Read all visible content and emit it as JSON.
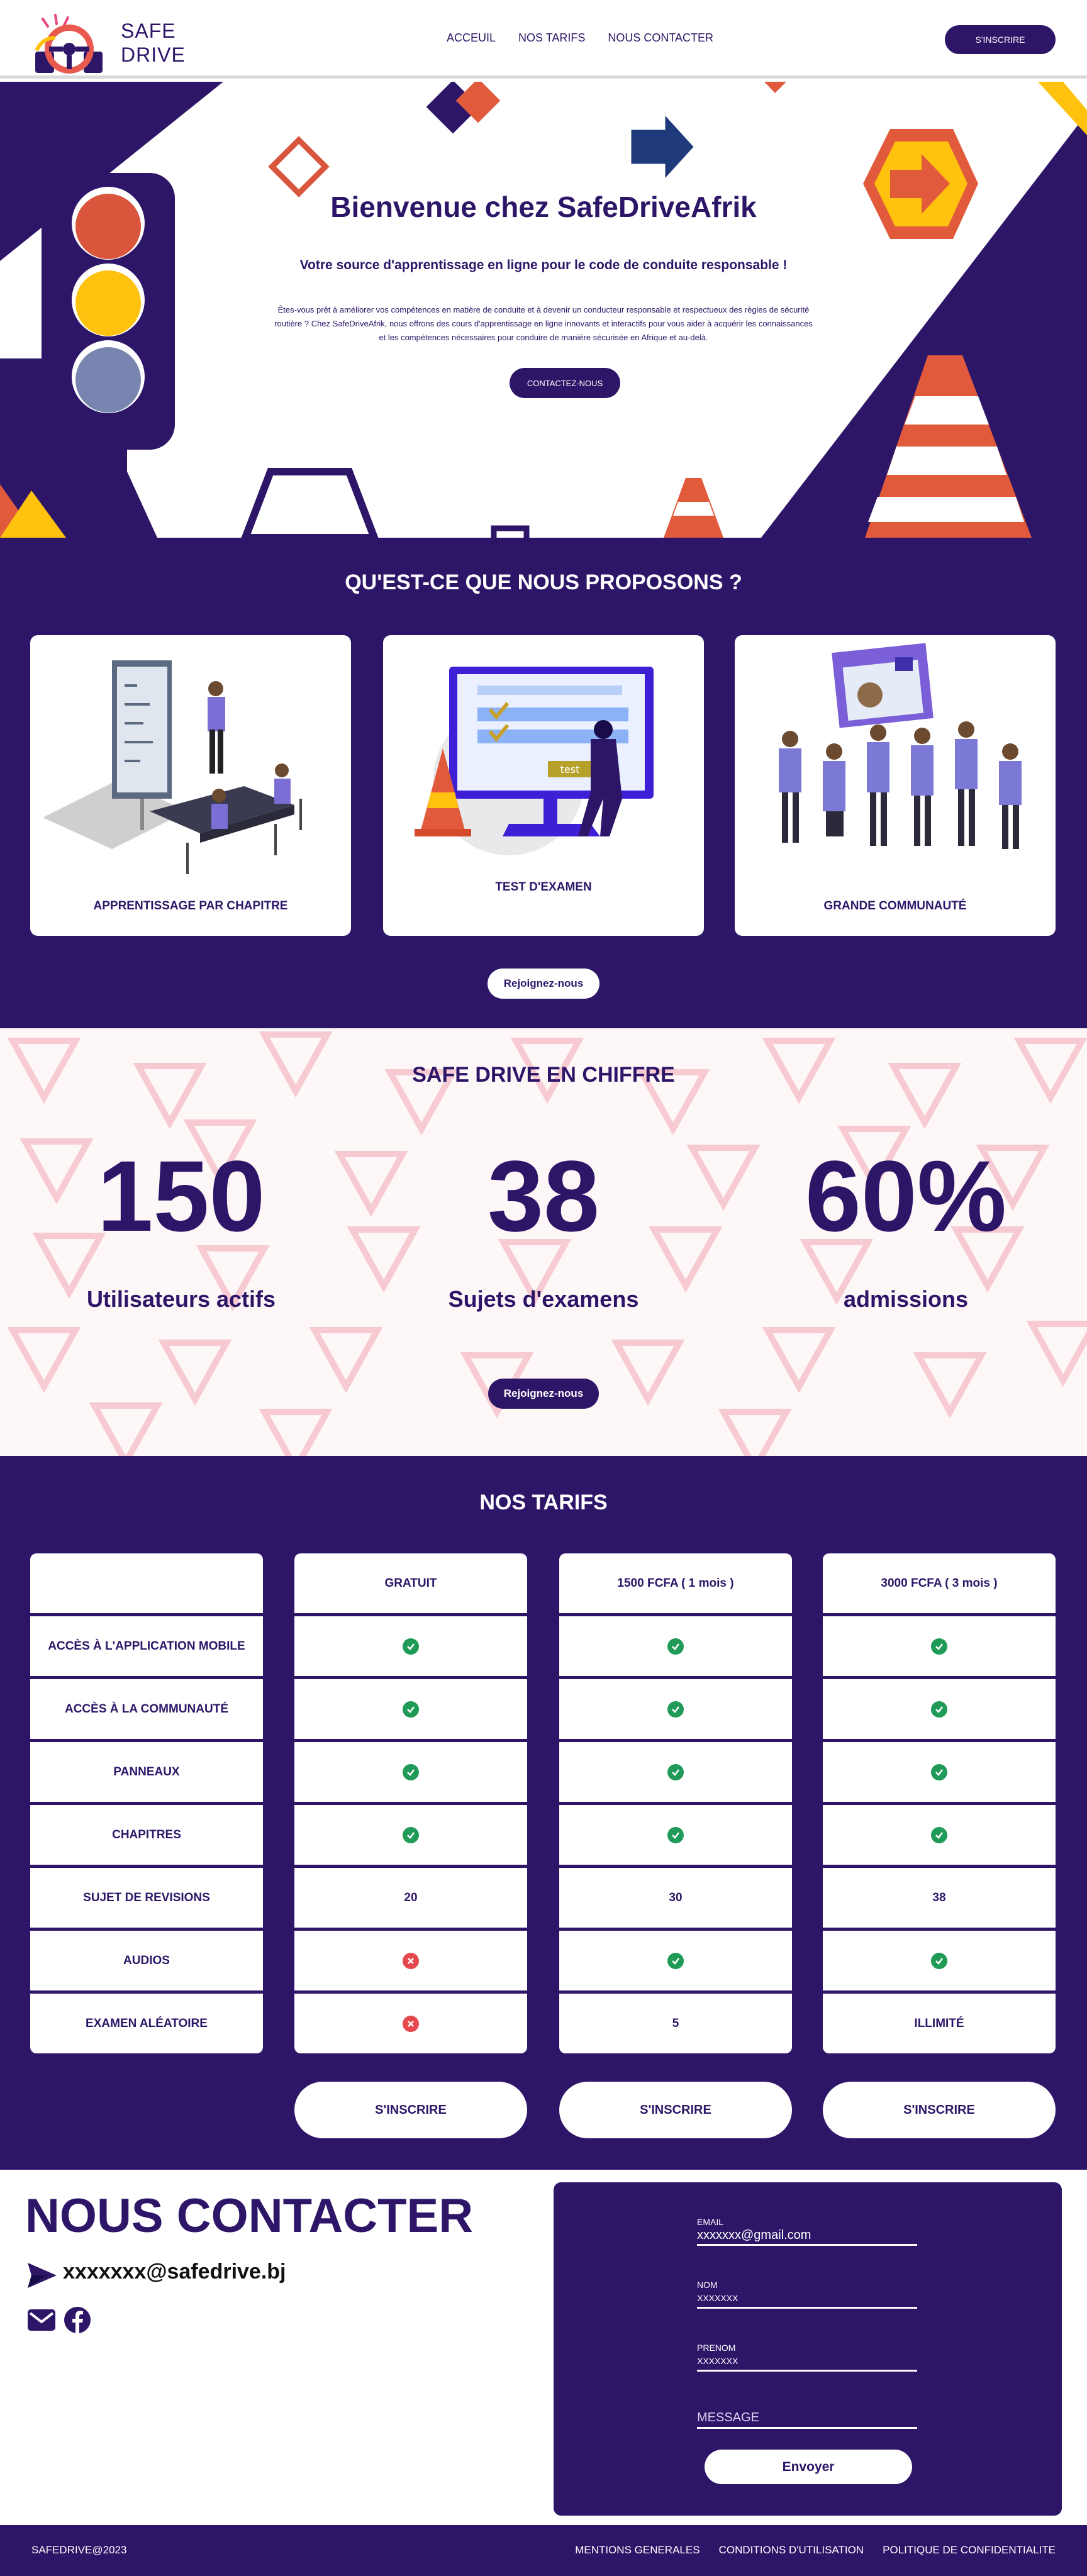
{
  "header": {
    "brand_line1": "SAFE",
    "brand_line2": "DRIVE",
    "nav": [
      "ACCEUIL",
      "NOS TARIFS",
      "NOUS CONTACTER"
    ],
    "signup_label": "S'INSCRIRE"
  },
  "hero": {
    "title": "Bienvenue chez SafeDriveAfrik",
    "subtitle": "Votre source d'apprentissage en ligne pour le code de conduite responsable !",
    "text": "Êtes-vous prêt à améliorer vos compétences en matière de conduite et à devenir un conducteur responsable et respectueux des règles de sécurité routière ? Chez SafeDriveAfrik, nous offrons des cours d'apprentissage en ligne innovants et interactifs pour vous aider à acquérir les connaissances et les compétences nécessaires pour conduire de manière sécurisée en Afrique et au-delà.",
    "contact_button": "CONTACTEZ-NOUS"
  },
  "offers": {
    "title": "QU'EST-CE QUE NOUS PROPOSONS ?",
    "cards": [
      {
        "label": "APPRENTISSAGE PAR CHAPITRE"
      },
      {
        "label": "TEST D'EXAMEN",
        "screen_text": "test"
      },
      {
        "label": "GRANDE COMMUNAUTÉ"
      }
    ],
    "join_button": "Rejoignez-nous"
  },
  "stats": {
    "title": "SAFE DRIVE EN CHIFFRE",
    "items": [
      {
        "value": "150",
        "label": "Utilisateurs actifs"
      },
      {
        "value": "38",
        "label": "Sujets d'examens"
      },
      {
        "value": "60%",
        "label": "admissions"
      }
    ],
    "join_button": "Rejoignez-nous"
  },
  "pricing": {
    "title": "NOS TARIFS",
    "features": [
      "ACCÈS À L'APPLICATION MOBILE",
      "ACCÈS À LA COMMUNAUTÉ",
      "PANNEAUX",
      "CHAPITRES",
      "SUJET DE REVISIONS",
      "AUDIOS",
      "EXAMEN ALÉATOIRE"
    ],
    "plans": [
      {
        "name": "GRATUIT",
        "values": [
          "check",
          "check",
          "check",
          "check",
          "20",
          "cross",
          "cross"
        ],
        "button": "S'INSCRIRE"
      },
      {
        "name": "1500 FCFA ( 1 mois )",
        "values": [
          "check",
          "check",
          "check",
          "check",
          "30",
          "check",
          "5"
        ],
        "button": "S'INSCRIRE"
      },
      {
        "name": "3000 FCFA ( 3 mois )",
        "values": [
          "check",
          "check",
          "check",
          "check",
          "38",
          "check",
          "ILLIMITÉ"
        ],
        "button": "S'INSCRIRE"
      }
    ],
    "colors": {
      "check": "#1f9a57",
      "cross": "#e5484d"
    }
  },
  "contact": {
    "title": "NOUS CONTACTER",
    "email": "xxxxxxx@safedrive.bj",
    "form": {
      "email_label": "EMAIL",
      "email_value": "xxxxxxx@gmail.com",
      "nom_label": "NOM",
      "nom_value": "XXXXXXX",
      "prenom_label": "PRENOM",
      "prenom_value": "XXXXXXX",
      "message_placeholder": "MESSAGE",
      "send_button": "Envoyer"
    }
  },
  "footer": {
    "copyright": "SAFEDRIVE@2023",
    "links": [
      "MENTIONS GENERALES",
      "CONDITIONS D'UTILISATION",
      "POLITIQUE DE CONFIDENTIALITE"
    ]
  },
  "colors": {
    "primary": "#2d1668",
    "accent_orange": "#e25a3c",
    "accent_yellow": "#ffc107"
  }
}
